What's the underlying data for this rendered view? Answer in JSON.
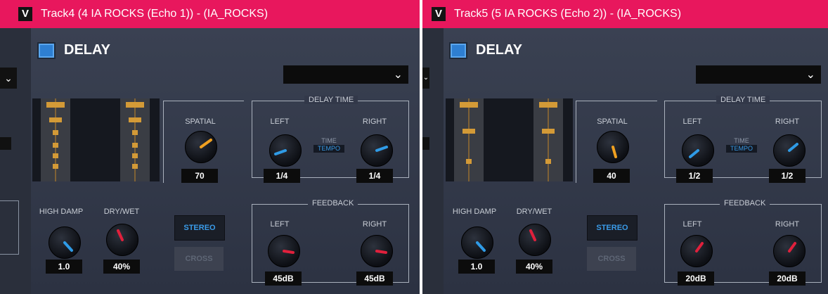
{
  "windows": [
    {
      "title": "Track4 (4 IA ROCKS (Echo 1)) - (IA_ROCKS)",
      "logo": "V",
      "plugin_name": "DELAY",
      "preset": "",
      "meters": {
        "left_levels": [
          0.95,
          0.75,
          0.58,
          0.42,
          0.28,
          0.14
        ],
        "right_levels": [
          0.95,
          0.75,
          0.58,
          0.42,
          0.28,
          0.14
        ]
      },
      "spatial": {
        "label": "SPATIAL",
        "value": "70",
        "color": "#f0a020"
      },
      "delay_time": {
        "title": "DELAY TIME",
        "left_label": "LEFT",
        "right_label": "RIGHT",
        "left_value": "1/4",
        "right_value": "1/4",
        "mode_top": "TIME",
        "mode_bottom": "TEMPO",
        "color": "#2f9be6"
      },
      "high_damp": {
        "label": "HIGH DAMP",
        "value": "1.0",
        "color": "#2f9be6"
      },
      "dry_wet": {
        "label": "DRY/WET",
        "value": "40%",
        "color": "#e0203c"
      },
      "modes": {
        "stereo": "STEREO",
        "cross": "CROSS"
      },
      "feedback": {
        "title": "FEEDBACK",
        "left_label": "LEFT",
        "right_label": "RIGHT",
        "left_value": "45dB",
        "right_value": "45dB",
        "color": "#e0203c"
      }
    },
    {
      "title": "Track5 (5 IA ROCKS (Echo 2)) - (IA_ROCKS)",
      "logo": "V",
      "plugin_name": "DELAY",
      "preset": "",
      "meters": {
        "left_levels": [
          0.95,
          0.6,
          0.2
        ],
        "right_levels": [
          0.95,
          0.6,
          0.2
        ]
      },
      "spatial": {
        "label": "SPATIAL",
        "value": "40",
        "color": "#f0a020"
      },
      "delay_time": {
        "title": "DELAY TIME",
        "left_label": "LEFT",
        "right_label": "RIGHT",
        "left_value": "1/2",
        "right_value": "1/2",
        "mode_top": "TIME",
        "mode_bottom": "TEMPO",
        "color": "#2f9be6"
      },
      "high_damp": {
        "label": "HIGH DAMP",
        "value": "1.0",
        "color": "#2f9be6"
      },
      "dry_wet": {
        "label": "DRY/WET",
        "value": "40%",
        "color": "#e0203c"
      },
      "modes": {
        "stereo": "STEREO",
        "cross": "CROSS"
      },
      "feedback": {
        "title": "FEEDBACK",
        "left_label": "LEFT",
        "right_label": "RIGHT",
        "left_value": "20dB",
        "right_value": "20dB",
        "color": "#e0203c"
      }
    }
  ]
}
